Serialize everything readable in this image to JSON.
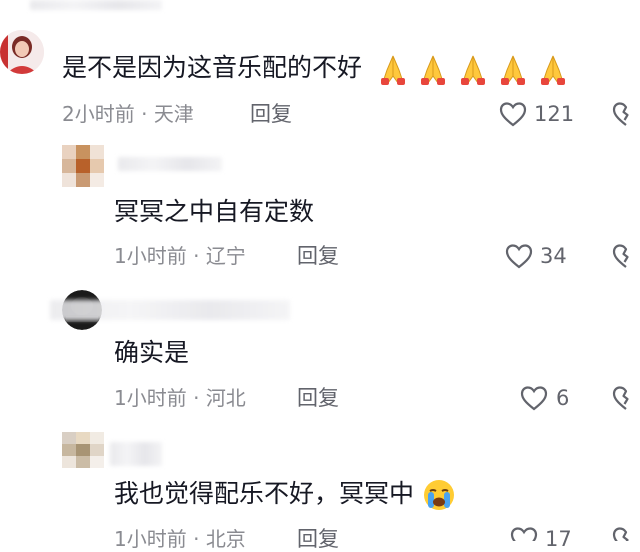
{
  "comments": [
    {
      "text": "是不是因为这音乐配的不好",
      "emoji": [
        "folded-hands",
        "folded-hands",
        "folded-hands",
        "folded-hands",
        "folded-hands"
      ],
      "time": "2小时前",
      "location": "天津",
      "reply": "回复",
      "likes": "121"
    },
    {
      "text": "冥冥之中自有定数",
      "time": "1小时前",
      "location": "辽宁",
      "reply": "回复",
      "likes": "34"
    },
    {
      "text": "确实是",
      "time": "1小时前",
      "location": "河北",
      "reply": "回复",
      "likes": "6"
    },
    {
      "text": "我也觉得配乐不好，冥冥中",
      "emoji": [
        "loudly-crying-face"
      ],
      "time": "1小时前",
      "location": "北京",
      "reply": "回复",
      "likes": "17"
    }
  ],
  "separator": "·",
  "colors": {
    "text": "#161823",
    "meta": "#8a8b91",
    "action": "#62646c",
    "background": "#ffffff"
  }
}
